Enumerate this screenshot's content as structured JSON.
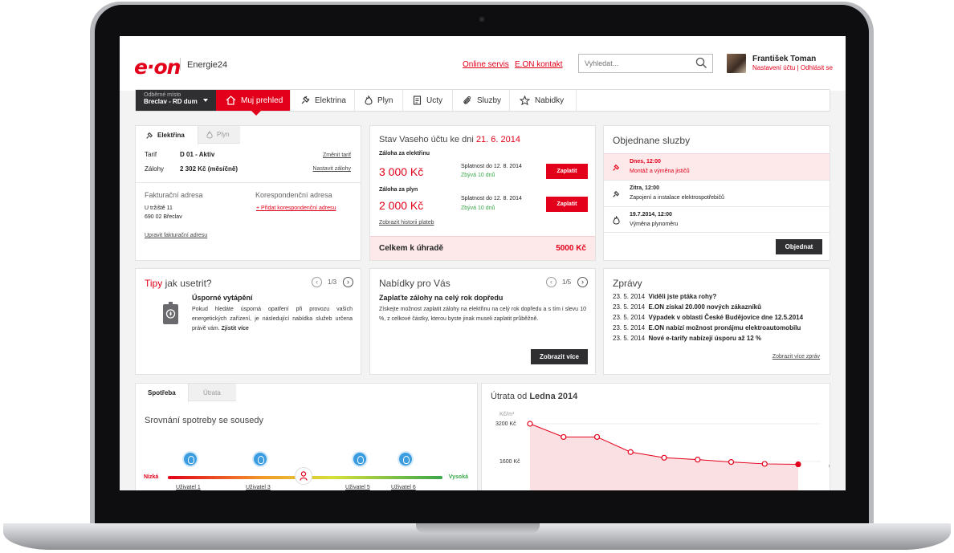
{
  "header": {
    "logo": "e·on",
    "brand": "Energie24",
    "links": [
      "Online servis",
      "E.ON kontakt"
    ],
    "search_placeholder": "Vyhledat...",
    "user_name": "František Toman",
    "user_actions": "Nastavení účtu | Odhlásit se"
  },
  "nav": {
    "site_label": "Odběrné místo",
    "site_value": "Breclav - RD dum",
    "tabs": [
      "Muj prehled",
      "Elektrina",
      "Plyn",
      "Ucty",
      "Sluzby",
      "Nabidky"
    ],
    "active_tab": 0
  },
  "contract": {
    "tabs": [
      "Elektřina",
      "Plyn"
    ],
    "tarif_label": "Tarif",
    "tarif_value": "D 01 - Aktiv",
    "tarif_link": "Změnit tarif",
    "zalohy_label": "Zálohy",
    "zalohy_value": "2 302 Kč (měsíčně)",
    "zalohy_link": "Nastavit zálohy",
    "billing_title": "Fakturační adresa",
    "billing_line1": "U tržiště 11",
    "billing_line2": "690 02 Břeclav",
    "corr_title": "Korespondenční adresa",
    "corr_link": "+ Přidat korespondenční adresu",
    "edit_link": "Upravit fakturační adresu"
  },
  "balance": {
    "title": "Stav Vaseho účtu ke dni",
    "date": "21. 6. 2014",
    "items": [
      {
        "label": "Záloha za elektřinu",
        "amount": "3 000 Kč",
        "due": "Splatnost do 12. 8. 2014",
        "left": "Zbývá 10 dnů",
        "pay": "Zaplatit"
      },
      {
        "label": "Záloha za plyn",
        "amount": "2 000 Kč",
        "due": "Splatnost do 12. 8. 2014",
        "left": "Zbývá 10 dnů",
        "pay": "Zaplatit"
      }
    ],
    "history_link": "Zobrazit historii plateb",
    "total_label": "Celkem k úhradě",
    "total_value": "5000 Kč"
  },
  "services": {
    "title": "Objednane sluzby",
    "items": [
      {
        "when": "Dnes, 12:00",
        "what": "Montáž a výměna jističů"
      },
      {
        "when": "Zitra, 12:00",
        "what": "Zapojení a instalace elektrospotřebičů"
      },
      {
        "when": "19.7.2014, 12:00",
        "what": "Výměna plynoměru"
      }
    ],
    "order": "Objednat"
  },
  "tips": {
    "title_red": "Tipy",
    "title_rest": " jak usetrit?",
    "counter": "1/3",
    "heading": "Úsporné vytápění",
    "text": "Pokud hledáte úsporná opatření při provozu vašich energetických zařízení, je následující nabídka služeb určena právě vám.",
    "more": "Zjistit více"
  },
  "offers": {
    "title": "Nabídky pro Vás",
    "counter": "1/5",
    "heading": "Zaplaťte zálohy na celý rok dopředu",
    "text": "Získejte možnost zaplatit zálohy na elektřinu na celý rok dopředu a s tím i slevu 10 %, z celkové částky, kterou byste jinak museli zaplatit průběžně.",
    "button": "Zobrazit více"
  },
  "news": {
    "title": "Zprávy",
    "items": [
      {
        "date": "23. 5. 2014",
        "text": "Viděli jste ptáka rohy?"
      },
      {
        "date": "23. 5. 2014",
        "text": "E.ON získal 20.000 nových zákazníků"
      },
      {
        "date": "23. 5. 2014",
        "text": "Výpadek v oblasti České Budějovice dne 12.5.2014"
      },
      {
        "date": "23. 5. 2014",
        "text": "E.ON nabízí možnost pronájmu elektroautomobilu"
      },
      {
        "date": "23. 5. 2014",
        "text": "Nové e-tarify nabízejí úsporu až 12 %"
      }
    ],
    "more": "Zobrazit více zpráv"
  },
  "consumption": {
    "tabs": [
      "Spotřeba",
      "Útrata"
    ],
    "title": "Srovnání spotreby se sousedy",
    "low": "Nízká",
    "high": "Vysoká",
    "users": [
      "Uživatel 1",
      "Uživatel 3",
      "Uživatel 5",
      "Uživatel 6"
    ]
  },
  "spend_chart_title": {
    "prefix": "Útrata od ",
    "bold": "Ledna 2014"
  },
  "chart_data": {
    "type": "line",
    "title": "Útrata od Ledna 2014",
    "ylabel": "Kč/m³",
    "yticks": [
      "3200 Kč",
      "1600 Kč"
    ],
    "ylim": [
      0,
      3600
    ],
    "series": [
      {
        "values": [
          3200,
          2640,
          2640,
          2000,
          1760,
          1680,
          1580,
          1500,
          1480
        ]
      }
    ],
    "highlight_last": true,
    "future_points": 1
  },
  "colors": {
    "brand": "#e2001a",
    "dark": "#2f2f32",
    "green": "#3aa64a",
    "blue": "#3b9ce0"
  }
}
